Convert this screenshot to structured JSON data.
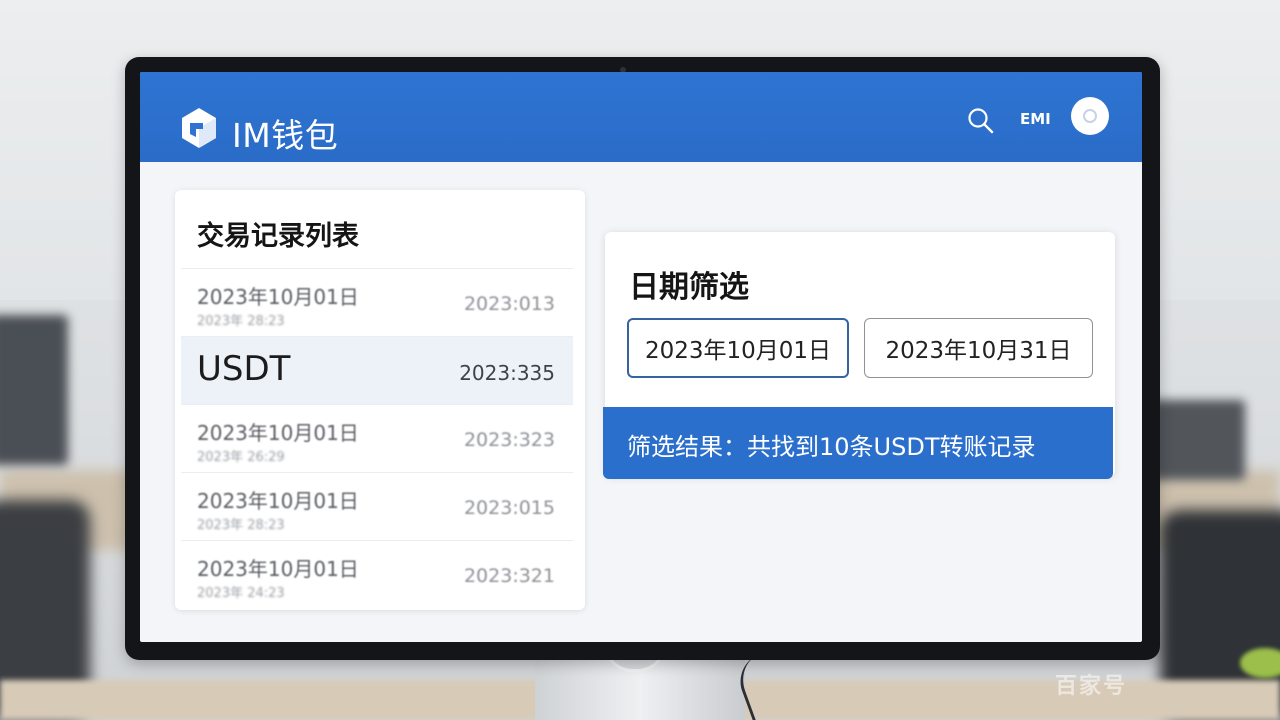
{
  "colors": {
    "header_blue": "#2f74d2",
    "result_blue": "#2b6fcd",
    "screen_bg": "#f3f5f8",
    "selected_row": "#edf1f8"
  },
  "header": {
    "app_title": "IM钱包",
    "logo_icon": "cube-logo-icon",
    "search_icon": "search-icon",
    "label": "EMI",
    "avatar_icon": "avatar-icon"
  },
  "transactions": {
    "title": "交易记录列表",
    "rows": [
      {
        "date": "2023年10月01日",
        "sub": "2023年 28:23",
        "amount": "2023:013",
        "selected": false
      },
      {
        "date": "USDT",
        "sub": "",
        "amount": "2023:335",
        "selected": true
      },
      {
        "date": "2023年10月01日",
        "sub": "2023年 26:29",
        "amount": "2023:323",
        "selected": false
      },
      {
        "date": "2023年10月01日",
        "sub": "2023年 28:23",
        "amount": "2023:015",
        "selected": false
      },
      {
        "date": "2023年10月01日",
        "sub": "2023年 24:23",
        "amount": "2023:321",
        "selected": false
      }
    ]
  },
  "filter": {
    "title": "日期筛选",
    "start_date": "2023年10月01日",
    "end_date": "2023年10月31日",
    "result": "筛选结果：共找到10条USDT转账记录"
  },
  "watermark": "百家号"
}
